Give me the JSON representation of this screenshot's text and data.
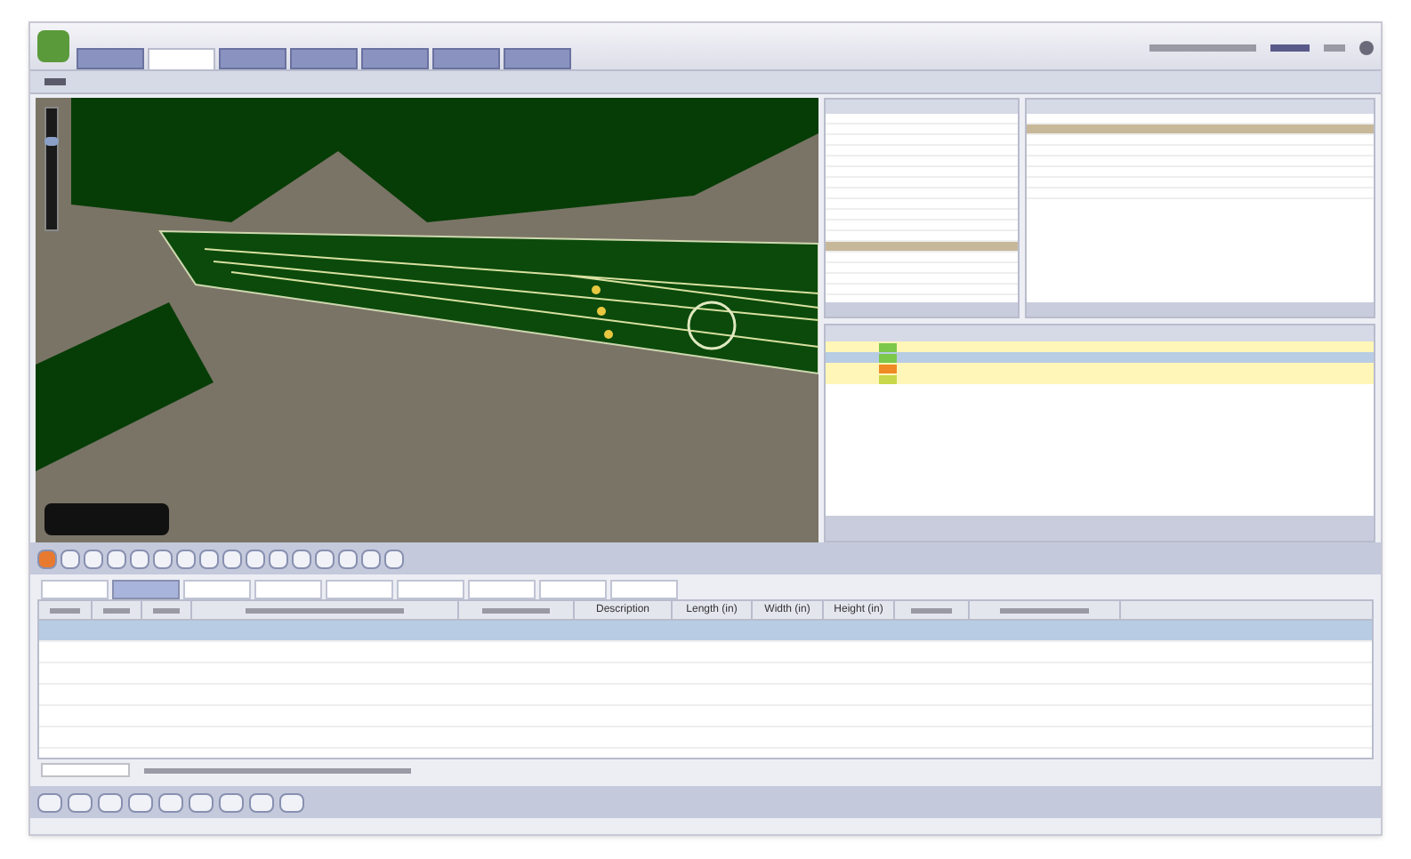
{
  "zoom_slider": {
    "level": 0.75
  },
  "top_tabs": [
    {
      "selected": false
    },
    {
      "selected": true
    },
    {
      "selected": false
    },
    {
      "selected": false
    },
    {
      "selected": false
    },
    {
      "selected": false
    },
    {
      "selected": false
    }
  ],
  "left_list": {
    "rows": [
      {
        "selected": false
      },
      {
        "selected": false
      },
      {
        "selected": false
      },
      {
        "selected": false
      },
      {
        "selected": false
      },
      {
        "selected": false
      },
      {
        "selected": false
      },
      {
        "selected": false
      },
      {
        "selected": false
      },
      {
        "selected": false
      },
      {
        "selected": false
      },
      {
        "selected": false
      },
      {
        "selected": true
      },
      {
        "selected": false
      },
      {
        "selected": false
      },
      {
        "selected": false
      },
      {
        "selected": false
      }
    ]
  },
  "right_table": {
    "rows": [
      {
        "selected": false
      },
      {
        "selected": true
      },
      {
        "selected": false
      },
      {
        "selected": false
      },
      {
        "selected": false
      },
      {
        "selected": false
      },
      {
        "selected": false
      },
      {
        "selected": false
      }
    ]
  },
  "lower_table": {
    "rows": [
      {
        "selected": false,
        "color": "#7cc84a"
      },
      {
        "selected": true,
        "color": "#7cc84a"
      },
      {
        "selected": false,
        "color": "#f08a24"
      },
      {
        "selected": false,
        "color": "#c8d84a"
      }
    ]
  },
  "bottom_tabs": [
    {
      "selected": false
    },
    {
      "selected": true
    },
    {
      "selected": false
    },
    {
      "selected": false
    },
    {
      "selected": false
    },
    {
      "selected": false
    },
    {
      "selected": false
    },
    {
      "selected": false
    },
    {
      "selected": false
    }
  ],
  "bottom_table": {
    "columns": [
      {
        "kind": "illegible"
      },
      {
        "kind": "illegible"
      },
      {
        "kind": "illegible"
      },
      {
        "kind": "illegible"
      },
      {
        "kind": "illegible"
      },
      {
        "kind": "text",
        "label": "Description"
      },
      {
        "kind": "text",
        "label": "Length (in)"
      },
      {
        "kind": "text",
        "label": "Width (in)"
      },
      {
        "kind": "text",
        "label": "Height (in)"
      },
      {
        "kind": "illegible"
      },
      {
        "kind": "illegible"
      }
    ],
    "rows": [
      {
        "selected": true
      },
      {
        "selected": false
      },
      {
        "selected": false
      },
      {
        "selected": false
      },
      {
        "selected": false
      },
      {
        "selected": false
      }
    ]
  }
}
